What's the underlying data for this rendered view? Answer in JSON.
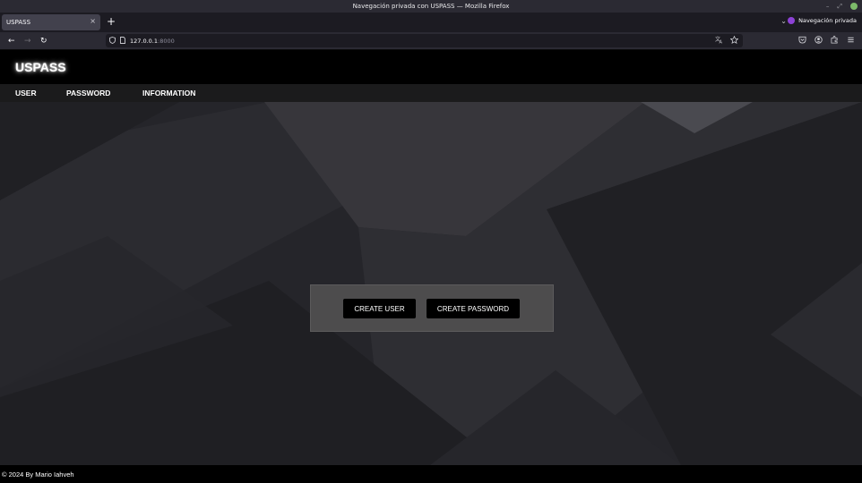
{
  "browser": {
    "window_title": "Navegación privada con USPASS — Mozilla Firefox",
    "window_controls": [
      "–",
      "⤢"
    ],
    "tab_title": "USPASS",
    "tab_close": "×",
    "new_tab": "+",
    "tab_list": "⌄",
    "private_label": "Navegación privada",
    "back": "←",
    "forward": "→",
    "reload": "↻",
    "url_host": "127.0.0.1",
    "url_port": ":8000",
    "icons": {
      "shield": "shield-icon",
      "page": "page-icon",
      "translate": "translate-icon",
      "bookmark": "star-icon",
      "pocket": "pocket-icon",
      "account": "account-icon",
      "extensions": "extensions-icon",
      "menu": "hamburger-menu-icon"
    }
  },
  "site": {
    "brand": "USPASS",
    "menu": [
      {
        "label": "USER"
      },
      {
        "label": "PASSWORD"
      },
      {
        "label": "INFORMATION"
      }
    ],
    "actions": {
      "create_user": "CREATE USER",
      "create_password": "CREATE PASSWORD"
    },
    "footer": "© 2024 By Mario Iahveh",
    "colors": {
      "header_bg": "#000000",
      "menu_bg": "#1b1b1c",
      "card_bg": "#4d4c4d",
      "button_bg": "#000000",
      "hero_bg": "#26262b"
    }
  }
}
